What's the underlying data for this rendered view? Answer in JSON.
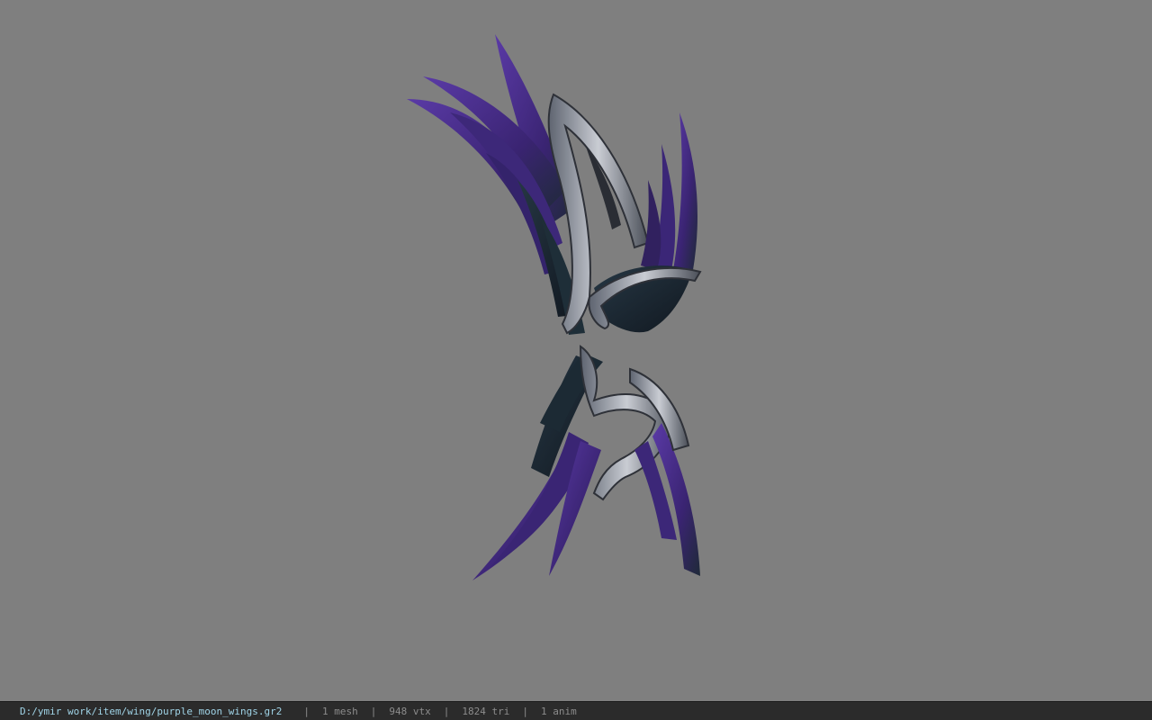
{
  "viewer": {
    "background_color": "#7f7f7f",
    "model": {
      "icon": "wings-model-icon",
      "colors": {
        "feather_purple": "#4b2d8c",
        "feather_dark": "#1d2a36",
        "metal": "#8a8f99"
      }
    }
  },
  "statusbar": {
    "file_path": "D:/ymir work/item/wing/purple_moon_wings.gr2",
    "separator": "|",
    "mesh_count": "1 mesh",
    "vertex_count": "948 vtx",
    "triangle_count": "1824 tri",
    "anim_count": "1 anim",
    "path_color": "#9fd3e6",
    "text_color": "#8c8c8c",
    "background_color": "#2b2b2b"
  }
}
